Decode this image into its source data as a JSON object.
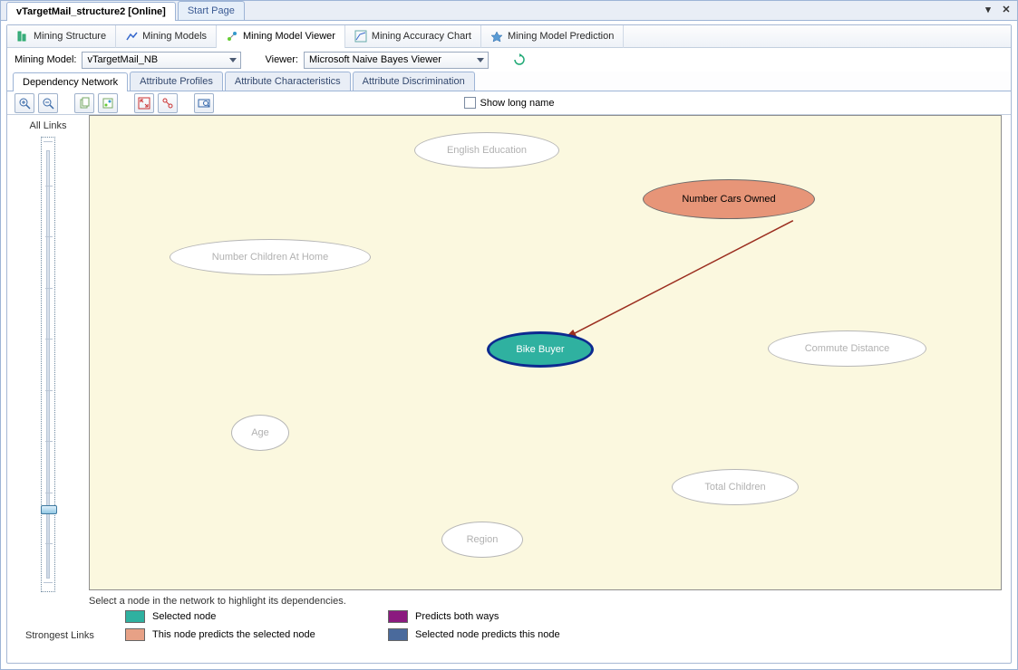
{
  "docTabs": {
    "active": "vTargetMail_structure2 [Online]",
    "other": "Start Page"
  },
  "mainTabs": {
    "structure": "Mining Structure",
    "models": "Mining Models",
    "viewer": "Mining Model Viewer",
    "accuracy": "Mining Accuracy Chart",
    "prediction": "Mining Model Prediction"
  },
  "selectors": {
    "miningModelLabel": "Mining Model:",
    "miningModelValue": "vTargetMail_NB",
    "viewerLabel": "Viewer:",
    "viewerValue": "Microsoft Naive Bayes Viewer"
  },
  "subTabs": {
    "dependency": "Dependency Network",
    "profiles": "Attribute Profiles",
    "characteristics": "Attribute Characteristics",
    "discrimination": "Attribute Discrimination"
  },
  "toolbar": {
    "showLong": "Show long name"
  },
  "slider": {
    "top": "All Links",
    "bottom": "Strongest Links"
  },
  "nodes": {
    "englishEducation": "English Education",
    "numberCarsOwned": "Number Cars Owned",
    "numberChildrenAtHome": "Number Children At Home",
    "bikeBuyer": "Bike Buyer",
    "commuteDistance": "Commute Distance",
    "age": "Age",
    "totalChildren": "Total Children",
    "region": "Region"
  },
  "footer": {
    "hint": "Select a node in the network to highlight its dependencies.",
    "selected": "Selected node",
    "predictsSelected": "This node predicts the selected node",
    "bothWays": "Predicts both ways",
    "selectedPredicts": "Selected node predicts this node"
  }
}
